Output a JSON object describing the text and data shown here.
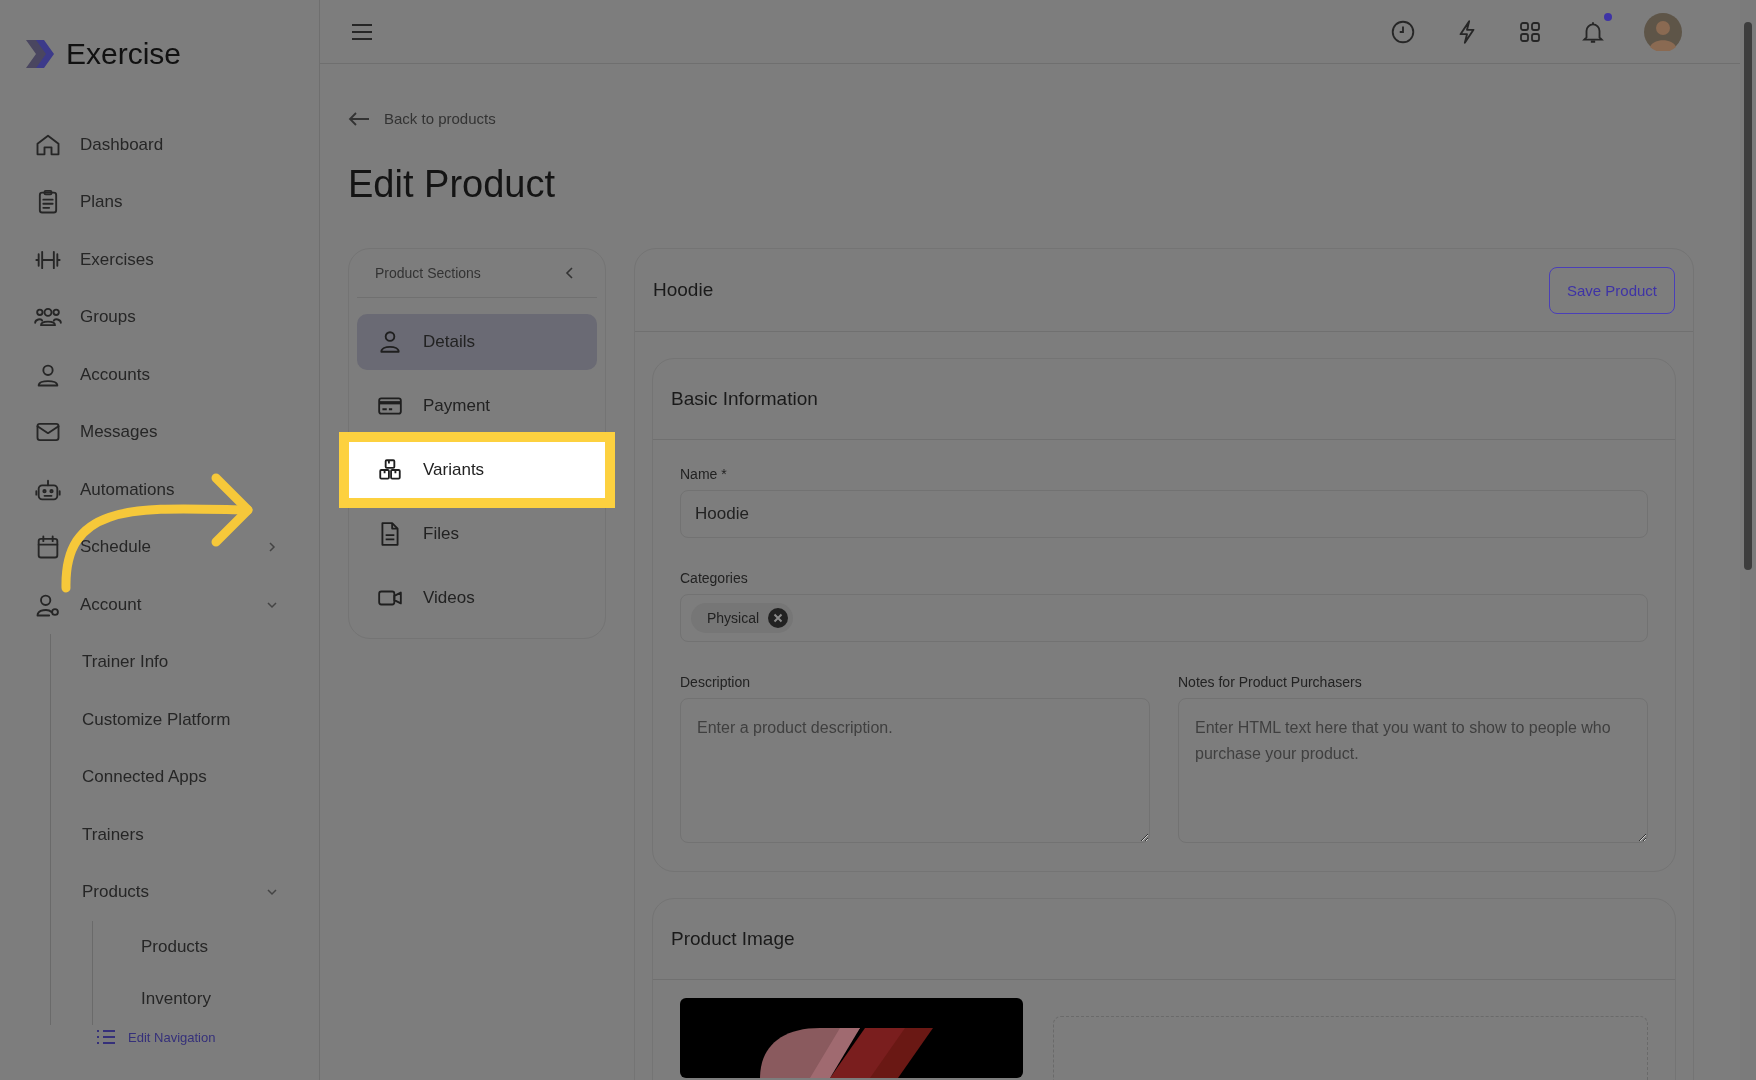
{
  "app": {
    "name": "Exercise"
  },
  "sidebar": {
    "items": [
      {
        "label": "Dashboard"
      },
      {
        "label": "Plans"
      },
      {
        "label": "Exercises"
      },
      {
        "label": "Groups"
      },
      {
        "label": "Accounts"
      },
      {
        "label": "Messages"
      },
      {
        "label": "Automations"
      },
      {
        "label": "Schedule",
        "expanded": false
      },
      {
        "label": "Account",
        "expanded": true,
        "children": [
          {
            "label": "Trainer Info"
          },
          {
            "label": "Customize Platform"
          },
          {
            "label": "Connected Apps"
          },
          {
            "label": "Trainers"
          },
          {
            "label": "Products",
            "expanded": true,
            "children": [
              {
                "label": "Products"
              },
              {
                "label": "Inventory"
              }
            ]
          }
        ]
      }
    ],
    "edit_link": "Edit Navigation"
  },
  "top_bar": {
    "notifications_unread": true
  },
  "back_link": "Back to products",
  "page_title": "Edit Product",
  "sections": {
    "title": "Product Sections",
    "items": [
      {
        "label": "Details",
        "selected": true,
        "highlighted": false
      },
      {
        "label": "Payment",
        "selected": false,
        "highlighted": false
      },
      {
        "label": "Variants",
        "selected": false,
        "highlighted": true
      },
      {
        "label": "Files",
        "selected": false,
        "highlighted": false
      },
      {
        "label": "Videos",
        "selected": false,
        "highlighted": false
      }
    ]
  },
  "product": {
    "title": "Hoodie",
    "save_button": "Save Product",
    "basic_info": {
      "title": "Basic Information",
      "name_label": "Name *",
      "name_value": "Hoodie",
      "categories_label": "Categories",
      "categories": [
        {
          "label": "Physical"
        }
      ],
      "description_label": "Description",
      "description_placeholder": "Enter a product description.",
      "notes_label": "Notes for Product Purchasers",
      "notes_placeholder": "Enter HTML text here that you want to show to people who purchase your product."
    },
    "image_section": {
      "title": "Product Image"
    }
  }
}
